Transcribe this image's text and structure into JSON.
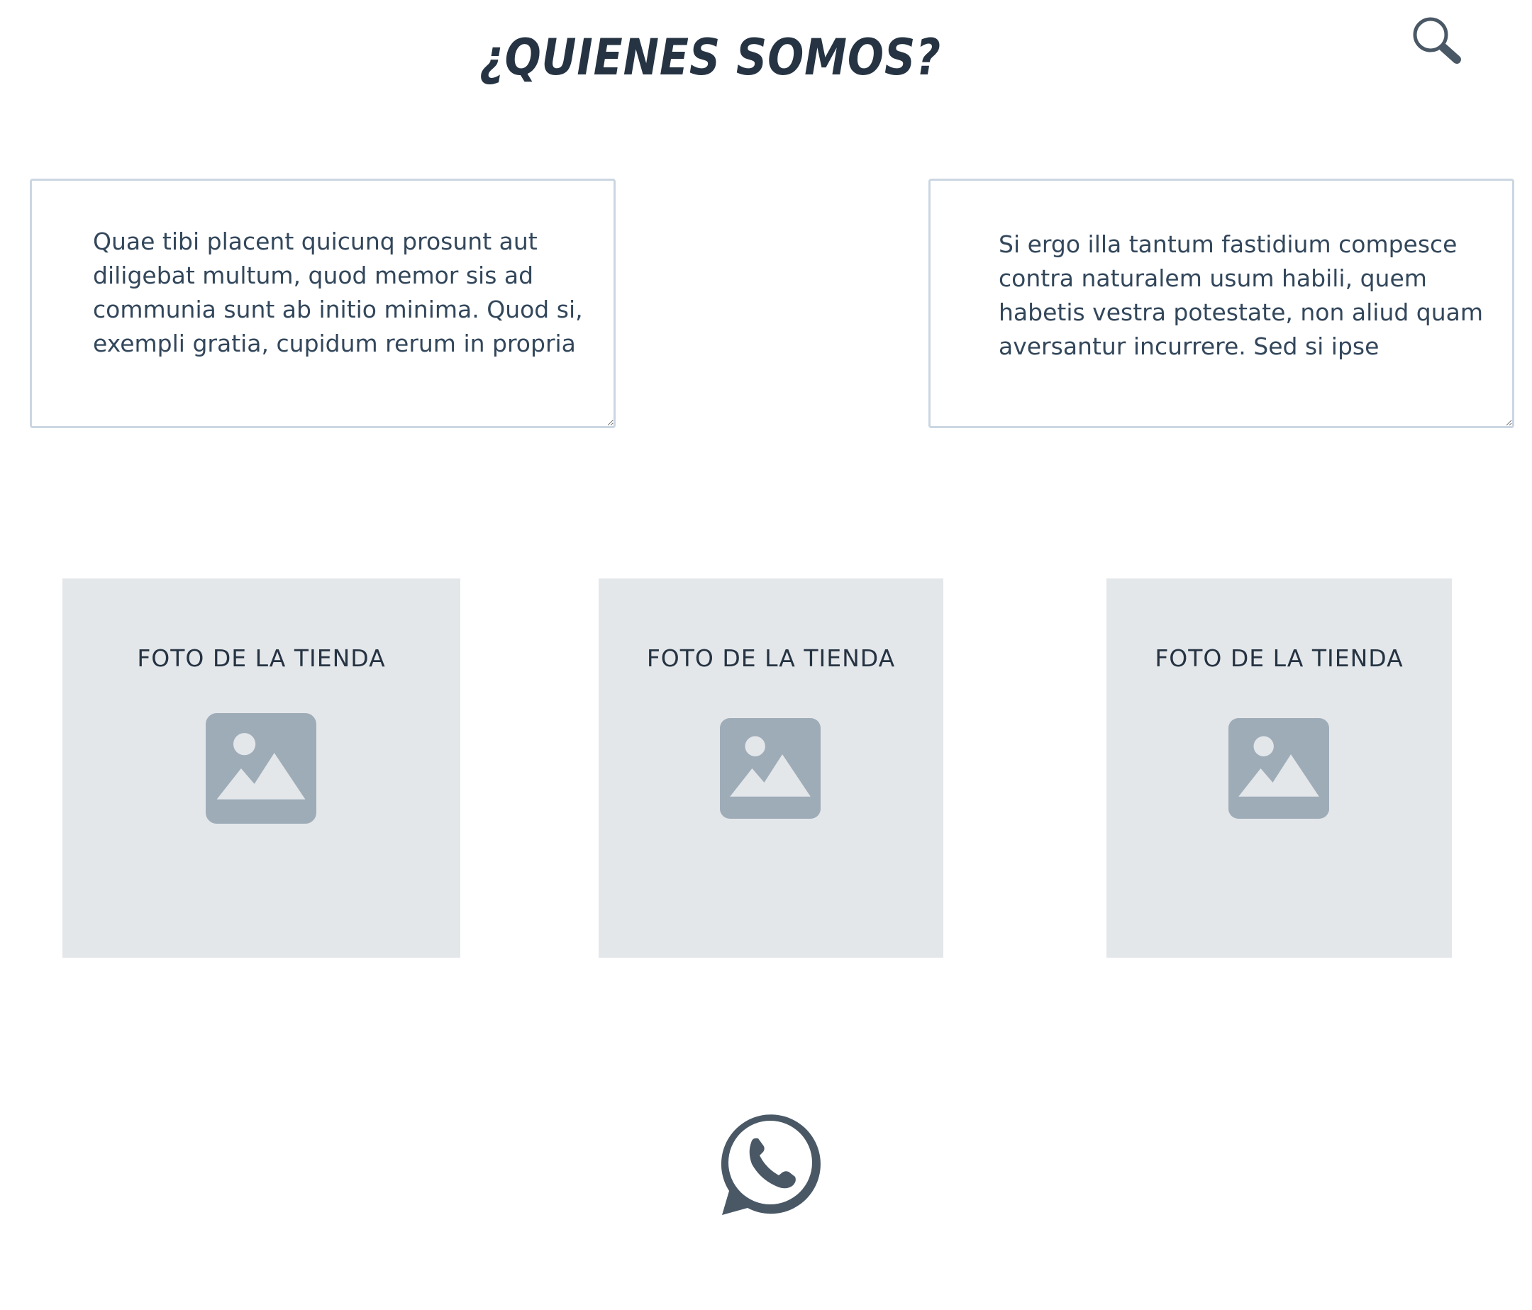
{
  "header": {
    "title": "¿QUIENES SOMOS?",
    "search_icon": "search-icon"
  },
  "text_areas": [
    {
      "value": "Quae tibi placent quicunq prosunt aut diligebat multum, quod memor sis ad communia sunt ab initio minima. Quod si, exempli gratia, cupidum rerum in propria"
    },
    {
      "value": "Si ergo illa tantum fastidium compesce contra naturalem usum habili, quem habetis vestra potestate, non aliud quam aversantur incurrere. Sed si ipse"
    }
  ],
  "photos": [
    {
      "label": "FOTO DE LA TIENDA",
      "icon": "image-placeholder-icon"
    },
    {
      "label": "FOTO DE LA TIENDA",
      "icon": "image-placeholder-icon"
    },
    {
      "label": "FOTO DE LA TIENDA",
      "icon": "image-placeholder-icon"
    }
  ],
  "footer": {
    "whatsapp_icon": "whatsapp-icon"
  },
  "colors": {
    "text_dark": "#253342",
    "textarea_border": "#cbd6e2",
    "photo_bg": "#e4e7ea",
    "photo_icon": "#9eacb8",
    "icon_slate": "#4a5866"
  }
}
